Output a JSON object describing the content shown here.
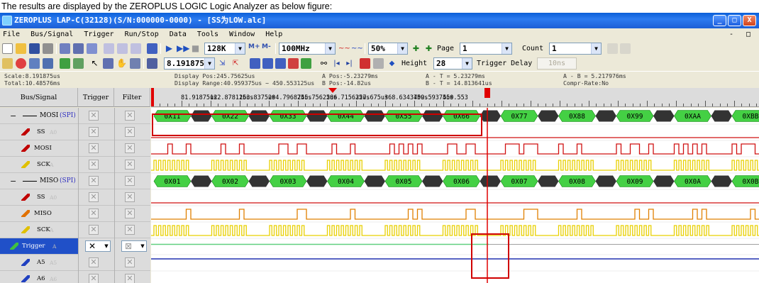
{
  "caption": "The results are displayed by the ZEROPLUS LOGIC Logic Analyzer as below figure:",
  "window": {
    "title": "ZEROPLUS LAP-C(32128)(S/N:000000-0000) - [SS为LOW.alc]",
    "buttons": [
      "_",
      "□",
      "X"
    ]
  },
  "menu": [
    "File",
    "Bus/Signal",
    "Trigger",
    "Run/Stop",
    "Data",
    "Tools",
    "Window",
    "Help"
  ],
  "mdi_buttons": "- □",
  "toolbar1": {
    "memory_depth": "128K",
    "sample_rate": "100MHz",
    "zoom": "50%",
    "page_label": "Page",
    "page_value": "1",
    "count_label": "Count",
    "count_value": "1"
  },
  "toolbar2": {
    "time_value": "8.191875u",
    "height_label": "Height",
    "height_value": "28",
    "trigger_delay_label": "Trigger Delay",
    "trigger_delay_value": "10ns"
  },
  "info": {
    "scale": "Scale:8.191875us",
    "total": "Total:10.48576ms",
    "display_pos": "Display Pos:245.75625us",
    "display_range": "Display Range:40.959375us ~ 450.553125us",
    "a_pos": "A Pos:-5.23279ms",
    "b_pos": "B Pos:-14.82us",
    "a_minus_t": "A - T = 5.23279ms",
    "b_minus_t": "B - T = 14.813641us",
    "a_minus_b": "A - B = 5.217976ms",
    "compr_rate": "Compr-Rate:No"
  },
  "columns": [
    "Bus/Signal",
    "Trigger",
    "Filter"
  ],
  "ruler_labels": [
    "81.91875us",
    "122.878125us",
    "163.8375us",
    "204.796875us",
    "245.75625us",
    "286.715625us",
    "327.675us",
    "368.634375us",
    "409.59375us",
    "450.553"
  ],
  "signals": [
    {
      "name": "MOSI",
      "tag": "(SPI)",
      "kind": "bus",
      "pen": "",
      "suffix": ""
    },
    {
      "name": "SS",
      "tag": "",
      "kind": "signal",
      "pen": "#c00000",
      "suffix": "A0"
    },
    {
      "name": "MOSI",
      "tag": "",
      "kind": "signal",
      "pen": "#c00000",
      "suffix": ""
    },
    {
      "name": "SCK",
      "tag": "",
      "kind": "signal",
      "pen": "#e0c000",
      "suffix": "A"
    },
    {
      "name": "MISO",
      "tag": "(SPI)",
      "kind": "bus",
      "pen": "",
      "suffix": ""
    },
    {
      "name": "SS",
      "tag": "",
      "kind": "signal",
      "pen": "#c00000",
      "suffix": "A0"
    },
    {
      "name": "MISO",
      "tag": "",
      "kind": "signal",
      "pen": "#e07000",
      "suffix": ""
    },
    {
      "name": "SCK",
      "tag": "",
      "kind": "signal",
      "pen": "#e0c000",
      "suffix": "A"
    },
    {
      "name": "Trigger",
      "tag": "",
      "kind": "trigger",
      "pen": "#40c040",
      "suffix": "A"
    },
    {
      "name": "A5",
      "tag": "",
      "kind": "signal",
      "pen": "#2040c0",
      "suffix": "A5"
    },
    {
      "name": "A6",
      "tag": "",
      "kind": "signal",
      "pen": "#2040c0",
      "suffix": "A6"
    }
  ],
  "mosi_bytes": [
    "0X11",
    "0X22",
    "0X33",
    "0X44",
    "0X55",
    "0X66",
    "0X77",
    "0X88",
    "0X99",
    "0XAA",
    "0XBB"
  ],
  "miso_bytes": [
    "0X01",
    "0X02",
    "0X03",
    "0X04",
    "0X05",
    "0X06",
    "0X07",
    "0X08",
    "0X09",
    "0X0A",
    "0X0B"
  ],
  "colors": {
    "bus_green": "#44d044",
    "bus_dark": "#333333",
    "wave_red": "#d01010",
    "wave_orange": "#e08000",
    "wave_yellow": "#e8d000",
    "trigger_green": "#60d080",
    "a5_blue": "#2030b0",
    "cursor_red": "#e00000",
    "highlight_red": "#d00000"
  }
}
